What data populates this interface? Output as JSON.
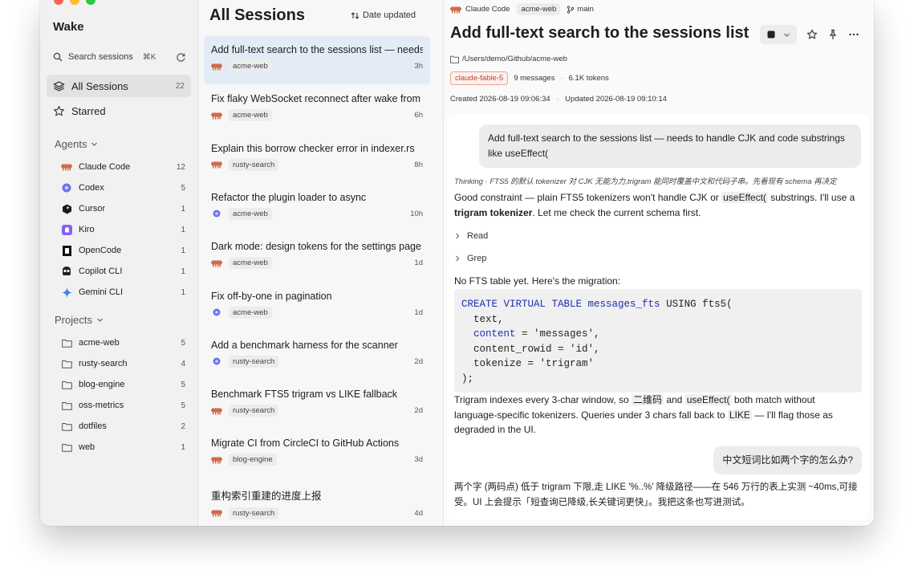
{
  "app": {
    "title": "Wake",
    "colors": {
      "traffic_close": "#ff5f57",
      "traffic_min": "#febc2e",
      "traffic_max": "#28c840",
      "selected_row": "#e3ebf6",
      "model_badge": "#c1452b"
    }
  },
  "sidebar": {
    "search_label": "Search sessions",
    "search_shortcut": "⌘K",
    "nav": [
      {
        "label": "All Sessions",
        "count": "22",
        "icon": "stack-icon"
      },
      {
        "label": "Starred",
        "icon": "star-icon"
      }
    ],
    "agents_header": "Agents",
    "agents": [
      {
        "label": "Claude Code",
        "count": "12",
        "icon": "claude-code-icon"
      },
      {
        "label": "Codex",
        "count": "5",
        "icon": "codex-icon"
      },
      {
        "label": "Cursor",
        "count": "1",
        "icon": "cursor-icon"
      },
      {
        "label": "Kiro",
        "count": "1",
        "icon": "kiro-icon"
      },
      {
        "label": "OpenCode",
        "count": "1",
        "icon": "opencode-icon"
      },
      {
        "label": "Copilot CLI",
        "count": "1",
        "icon": "copilot-icon"
      },
      {
        "label": "Gemini CLI",
        "count": "1",
        "icon": "gemini-icon"
      }
    ],
    "projects_header": "Projects",
    "projects": [
      {
        "label": "acme-web",
        "count": "5"
      },
      {
        "label": "rusty-search",
        "count": "4"
      },
      {
        "label": "blog-engine",
        "count": "5"
      },
      {
        "label": "oss-metrics",
        "count": "5"
      },
      {
        "label": "dotfiles",
        "count": "2"
      },
      {
        "label": "web",
        "count": "1"
      }
    ]
  },
  "list": {
    "title": "All Sessions",
    "sort_label": "Date updated",
    "sessions": [
      {
        "title": "Add full-text search to the sessions list — needs to handle CJK",
        "project": "acme-web",
        "time": "3h",
        "agent": "claude"
      },
      {
        "title": "Fix flaky WebSocket reconnect after wake from sleep",
        "project": "acme-web",
        "time": "6h",
        "agent": "claude"
      },
      {
        "title": "Explain this borrow checker error in indexer.rs",
        "project": "rusty-search",
        "time": "8h",
        "agent": "claude"
      },
      {
        "title": "Refactor the plugin loader to async",
        "project": "acme-web",
        "time": "10h",
        "agent": "codex"
      },
      {
        "title": "Dark mode: design tokens for the settings page",
        "project": "acme-web",
        "time": "1d",
        "agent": "claude"
      },
      {
        "title": "Fix off-by-one in pagination",
        "project": "acme-web",
        "time": "1d",
        "agent": "codex"
      },
      {
        "title": "Add a benchmark harness for the scanner",
        "project": "rusty-search",
        "time": "2d",
        "agent": "codex"
      },
      {
        "title": "Benchmark FTS5 trigram vs LIKE fallback",
        "project": "rusty-search",
        "time": "2d",
        "agent": "claude"
      },
      {
        "title": "Migrate CI from CircleCI to GitHub Actions",
        "project": "blog-engine",
        "time": "3d",
        "agent": "claude"
      },
      {
        "title": "重构索引重建的进度上报",
        "project": "rusty-search",
        "time": "4d",
        "agent": "claude"
      }
    ]
  },
  "detail": {
    "agent": "Claude Code",
    "project": "acme-web",
    "branch": "main",
    "title": "Add full-text search to the sessions list — needs to handle CJK",
    "path": "/Users/demo/Github/acme-web",
    "model": "claude-fable-5",
    "messages": "9 messages",
    "tokens": "6.1K tokens",
    "created": "Created 2026-08-19 09:06:34",
    "updated": "Updated 2026-08-19 09:10:14",
    "user_msg_1": "Add full-text search to the sessions list — needs to handle CJK and code substrings like useEffect(",
    "thinking": "Thinking · FTS5 的默认 tokenizer 对 CJK 无能为力,trigram 能同时覆盖中文和代码子串。先看现有 schema 再决定",
    "reply_1a": "Good constraint — plain FTS5 tokenizers won't handle CJK or ",
    "reply_1_code": "useEffect(",
    "reply_1b": " substrings. I'll use a ",
    "reply_1_bold": "trigram tokenizer",
    "reply_1c": ". Let me check the current schema first.",
    "tool_1": "Read",
    "tool_2": "Grep",
    "reply_2": "No FTS table yet. Here's the migration:",
    "code": {
      "l1_kw": "CREATE VIRTUAL TABLE",
      "l1_name": "messages_fts",
      "l1_rest": " USING fts5(",
      "l2": "  text,",
      "l3_key": "content",
      "l3_rest": " = 'messages',",
      "l4": "  content_rowid = 'id',",
      "l5": "  tokenize = 'trigram'",
      "l6": ");"
    },
    "reply_3a": "Trigram indexes every 3-char window, so ",
    "reply_3_c1": "二维码",
    "reply_3b": " and ",
    "reply_3_c2": "useEffect(",
    "reply_3c": " both match without language-specific tokenizers. Queries under 3 chars fall back to ",
    "reply_3_c3": "LIKE",
    "reply_3d": " — I'll flag those as degraded in the UI.",
    "user_msg_2": "中文短词比如两个字的怎么办?",
    "reply_4": "两个字 (两码点) 低于 trigram 下限,走 LIKE '%..%' 降级路径——在 546 万行的表上实测 ~40ms,可接受。UI 上会提示「短查询已降级,长关键词更快」。我把这条也写进测试。"
  }
}
